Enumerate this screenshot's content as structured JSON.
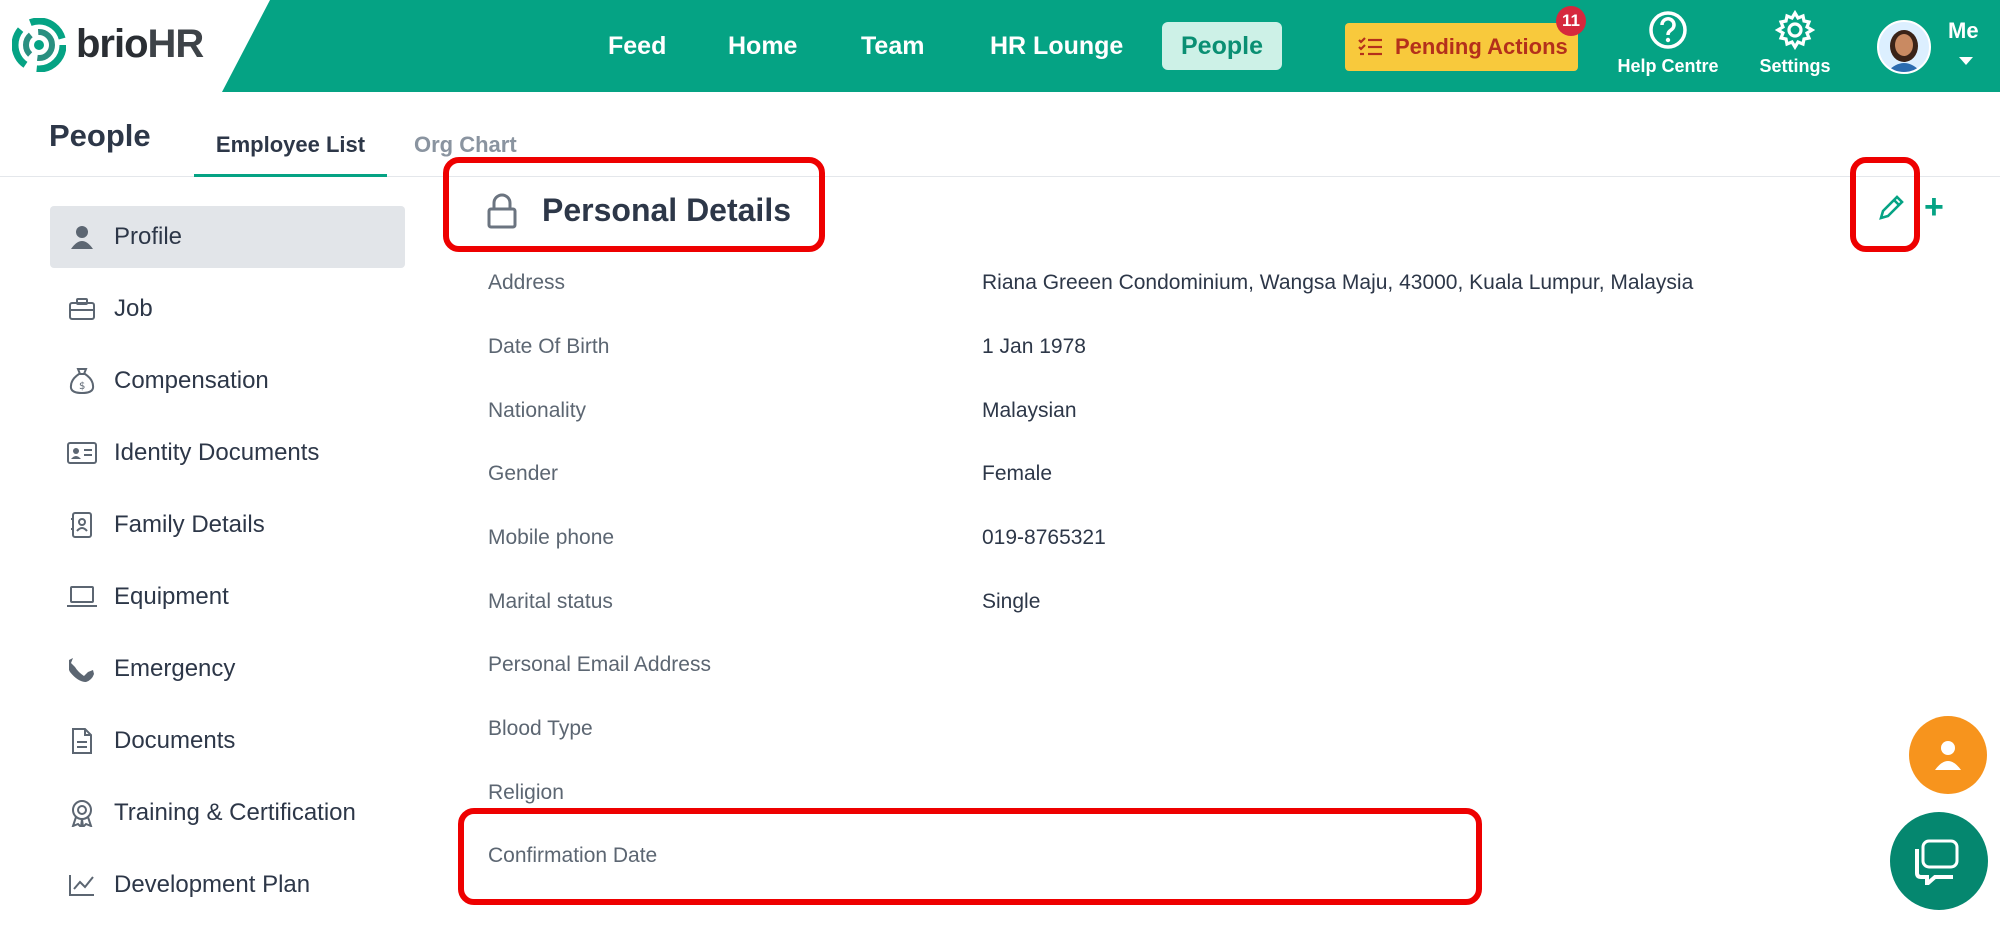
{
  "brand": {
    "name_main": "brio",
    "name_suffix": "HR"
  },
  "nav": {
    "items": [
      {
        "label": "Feed"
      },
      {
        "label": "Home"
      },
      {
        "label": "Team"
      },
      {
        "label": "HR Lounge"
      },
      {
        "label": "People"
      }
    ],
    "active": "People",
    "pending_label": "Pending Actions",
    "pending_count": "11",
    "help_label": "Help Centre",
    "settings_label": "Settings",
    "me_label": "Me"
  },
  "subheader": {
    "title": "People",
    "tabs": [
      {
        "label": "Employee List"
      },
      {
        "label": "Org Chart"
      }
    ]
  },
  "sidebar": {
    "items": [
      {
        "label": "Profile",
        "icon": "person-icon"
      },
      {
        "label": "Job",
        "icon": "briefcase-icon"
      },
      {
        "label": "Compensation",
        "icon": "money-bag-icon"
      },
      {
        "label": "Identity Documents",
        "icon": "id-card-icon"
      },
      {
        "label": "Family Details",
        "icon": "contact-book-icon"
      },
      {
        "label": "Equipment",
        "icon": "laptop-icon"
      },
      {
        "label": "Emergency",
        "icon": "phone-icon"
      },
      {
        "label": "Documents",
        "icon": "document-icon"
      },
      {
        "label": "Training & Certification",
        "icon": "award-icon"
      },
      {
        "label": "Development Plan",
        "icon": "chart-line-icon"
      }
    ]
  },
  "section": {
    "title": "Personal Details",
    "fields": [
      {
        "label": "Address",
        "value": "Riana Greeen Condominium, Wangsa Maju, 43000, Kuala Lumpur, Malaysia"
      },
      {
        "label": "Date Of Birth",
        "value": "1 Jan 1978"
      },
      {
        "label": "Nationality",
        "value": "Malaysian"
      },
      {
        "label": "Gender",
        "value": "Female"
      },
      {
        "label": "Mobile phone",
        "value": "019-8765321"
      },
      {
        "label": "Marital status",
        "value": "Single"
      },
      {
        "label": "Personal Email Address",
        "value": ""
      },
      {
        "label": "Blood Type",
        "value": ""
      },
      {
        "label": "Religion",
        "value": ""
      },
      {
        "label": "Confirmation Date",
        "value": ""
      }
    ]
  },
  "colors": {
    "brand_green": "#05a384",
    "pending_yellow": "#f8c93c",
    "badge_red": "#d6283d",
    "highlight_red": "#ee0000",
    "fab_orange": "#f7941d"
  }
}
